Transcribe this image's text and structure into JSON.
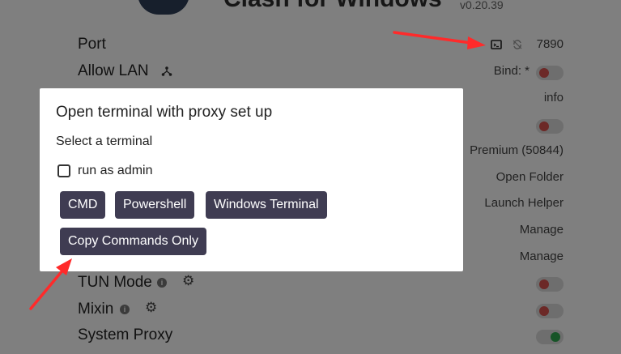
{
  "header": {
    "title": "Clash for Windows",
    "version": "v0.20.39"
  },
  "settings": {
    "port": {
      "label": "Port",
      "value": "7890"
    },
    "allow_lan": {
      "label": "Allow LAN",
      "bind": "Bind: *"
    },
    "right_values": {
      "info": "info",
      "premium": "Premium (50844)",
      "open_folder": "Open Folder",
      "launch_helper": "Launch Helper",
      "manage1": "Manage",
      "manage2": "Manage"
    },
    "tun_mode": {
      "label": "TUN Mode"
    },
    "mixin": {
      "label": "Mixin"
    },
    "system_proxy": {
      "label": "System Proxy"
    },
    "info_glyph": "i",
    "gear_glyph": "⚙",
    "colors": {
      "toggle_off": "#d9534f",
      "toggle_on": "#2fa84f",
      "button_bg": "#3f3c52",
      "arrow": "#ff2a2a"
    }
  },
  "modal": {
    "title": "Open terminal with proxy set up",
    "subtitle": "Select a terminal",
    "checkbox_label": "run as admin",
    "buttons": {
      "cmd": "CMD",
      "powershell": "Powershell",
      "windows_terminal": "Windows Terminal",
      "copy_commands": "Copy Commands Only"
    }
  }
}
